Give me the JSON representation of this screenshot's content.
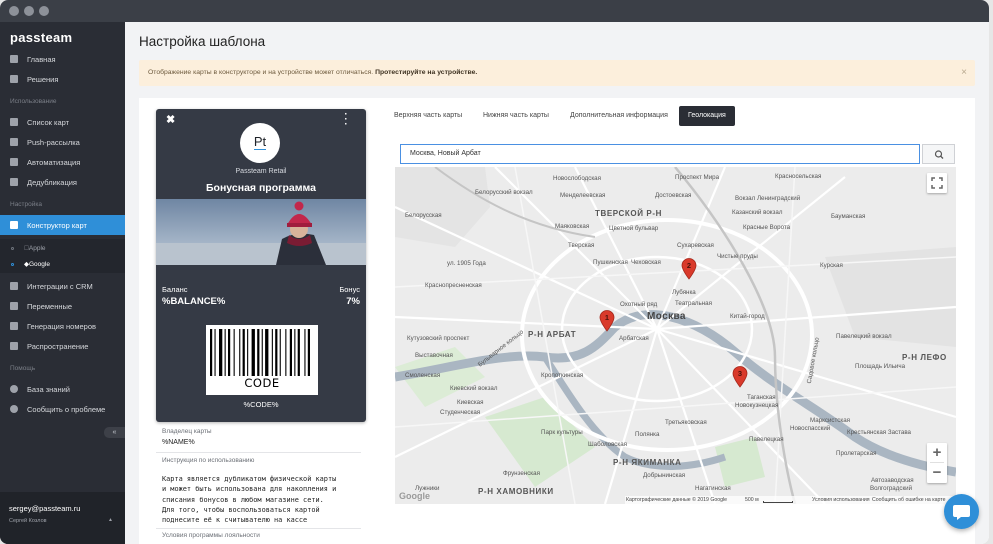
{
  "sidebar": {
    "logo": "passteam",
    "items": [
      {
        "label": "Главная"
      },
      {
        "label": "Решения"
      },
      {
        "label": "Список карт"
      },
      {
        "label": "Push-рассылка"
      },
      {
        "label": "Автоматизация"
      },
      {
        "label": "Дедубликация"
      },
      {
        "label": "Конструктор карт"
      },
      {
        "label": "Интеграции с CRM"
      },
      {
        "label": "Переменные"
      },
      {
        "label": "Генерация номеров"
      },
      {
        "label": "Распространение"
      },
      {
        "label": "База знаний"
      },
      {
        "label": "Сообщить о проблеме"
      }
    ],
    "sections": [
      "Использование",
      "Настройка",
      "Помощь"
    ],
    "sub_items": [
      {
        "label": "Apple"
      },
      {
        "label": "Google"
      }
    ],
    "collapse_label": "«",
    "user_email": "sergey@passteam.ru",
    "user_name": "Сергей Козлов"
  },
  "page": {
    "title": "Настройка шаблона",
    "alert_text": "Отображение карты в конструкторе и на устройстве может отличаться. ",
    "alert_bold": "Протестируйте на устройстве.",
    "alert_close": "×"
  },
  "card": {
    "logo_text": "Pt",
    "org_name": "Passteam Retail",
    "program_title": "Бонусная программа",
    "balance_label": "Баланс",
    "balance_value": "%BALANCE%",
    "bonus_label": "Бонус",
    "bonus_value": "7%",
    "barcode_text": "CODE",
    "code_value": "%CODE%"
  },
  "fields": {
    "owner_label": "Владелец карты",
    "owner_value": "%NAME%",
    "instruction_label": "Инструкция по использованию",
    "instruction_lines": [
      "Карта является дубликатом физической карты",
      "и может быть использована для накопления и",
      "списания бонусов в любом магазине сети.",
      "Для того, чтобы воспользоваться картой",
      "поднесите её к считывателю на кассе"
    ],
    "terms_label": "Условия программы лояльности"
  },
  "tabs": [
    {
      "label": "Верхняя часть карты"
    },
    {
      "label": "Нижняя часть карты"
    },
    {
      "label": "Дополнительная информация"
    },
    {
      "label": "Геолокация"
    }
  ],
  "search": {
    "value": "Москва, Новый Арбат"
  },
  "map": {
    "city": "Москва",
    "districts": [
      "ТВЕРСКОЙ Р-Н",
      "Р-Н АРБАТ",
      "Р-Н ЯКИМАНКА",
      "Р-Н ХАМОВНИКИ",
      "Р-Н ЛЕФО"
    ],
    "labels": [
      "Белорусский вокзал",
      "Новослободская",
      "Проспект Мира",
      "Красносельская",
      "Менделеевская",
      "Достоевская",
      "Вокзал Ленинградский",
      "Бауманская",
      "Маяковская",
      "Цветной бульвар",
      "Казанский вокзал",
      "Красные Ворота",
      "Белорусская",
      "Тверская",
      "Сухаревская",
      "Чистые пруды",
      "Курская",
      "ул. 1905 Года",
      "Пушкинская",
      "Чеховская",
      "Лубянка",
      "Театральная",
      "Краснопресненская",
      "Охотный ряд",
      "Китай-город",
      "Арбатская",
      "Павелецкий вокзал",
      "Выставочная",
      "Площадь Ильича",
      "Киевский вокзал",
      "Таганская",
      "Кропоткинская",
      "Новокузнецкая",
      "Смоленская",
      "Студенческая",
      "Парк культуры",
      "Павелецкая",
      "Пролетарская",
      "Фрунзенская",
      "Автозаводская",
      "Кутузовский проспект",
      "Марксистская",
      "Нагатинская",
      "Садовое кольцо",
      "Волгоградский",
      "Новоспасский",
      "Лужники",
      "Третьяковская",
      "Крестьянская Застава",
      "Шаболовская",
      "Киевская",
      "Полянка",
      "Добрынинская",
      "Бульварное кольцо"
    ],
    "footer_data": "Картографические данные © 2019 Google",
    "footer_scale": "500 м",
    "footer_terms": "Условия использования",
    "footer_report": "Сообщить об ошибке на карте",
    "google": "Google",
    "markers": [
      "1",
      "2",
      "3"
    ],
    "zoom_in": "+",
    "zoom_out": "−"
  }
}
